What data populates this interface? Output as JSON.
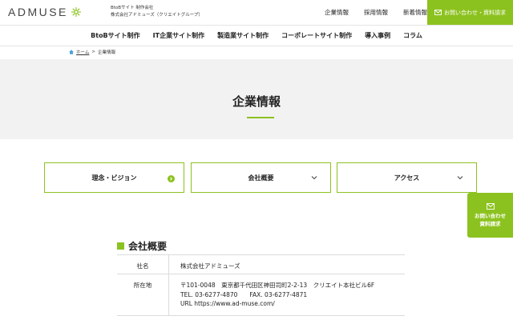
{
  "header": {
    "logo_text": "ADMUSE",
    "tagline_line1": "BtoBサイト 制作会社",
    "tagline_line2": "株式会社アドミューズ（クリエイトグループ）",
    "nav": [
      "企業情報",
      "採用情報",
      "新着情報"
    ],
    "contact_label": "お問い合わせ・資料請求"
  },
  "main_nav": [
    "BtoBサイト制作",
    "IT企業サイト制作",
    "製造業サイト制作",
    "コーポレートサイト制作",
    "導入事例",
    "コラム"
  ],
  "breadcrumb": {
    "home": "ホーム",
    "sep": ">",
    "current": "企業情報"
  },
  "hero": {
    "title": "企業情報"
  },
  "tabs": [
    "理念・ビジョン",
    "会社概要",
    "アクセス"
  ],
  "side_contact": {
    "line1": "お問い合わせ",
    "line2": "資料請求"
  },
  "section": {
    "title": "会社概要",
    "rows": [
      {
        "label": "社名",
        "lines": [
          "株式会社アドミューズ"
        ]
      },
      {
        "label": "所在地",
        "lines": [
          "〒101-0048　東京都千代田区神田司町2-2-13　クリエイト本社ビル6F",
          "TEL. 03-6277-4870　　FAX. 03-6277-4871",
          "URL https://www.ad-muse.com/"
        ]
      }
    ]
  },
  "colors": {
    "accent": "#8cc21f",
    "hero_bg": "#f2f2f2"
  }
}
